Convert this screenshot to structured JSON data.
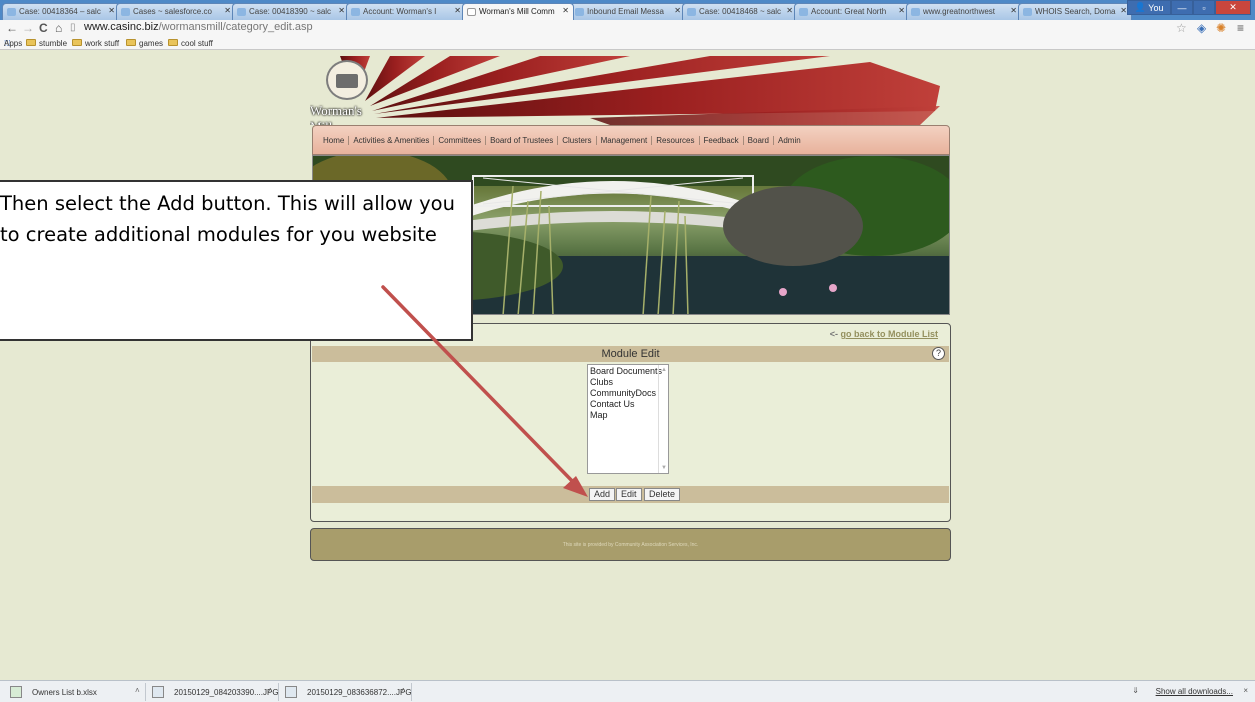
{
  "browser": {
    "tabs": [
      {
        "title": "Case: 00418364 – salc",
        "active": false
      },
      {
        "title": "Cases ~ salesforce.co",
        "active": false
      },
      {
        "title": "Case: 00418390 ~ salc",
        "active": false
      },
      {
        "title": "Account: Worman's I",
        "active": false
      },
      {
        "title": "Worman's Mill Comm",
        "active": true
      },
      {
        "title": "Inbound Email Messa",
        "active": false
      },
      {
        "title": "Case: 00418468 ~ salc",
        "active": false
      },
      {
        "title": "Account: Great North",
        "active": false
      },
      {
        "title": "www.greatnorthwest",
        "active": false
      },
      {
        "title": "WHOIS Search, Doma",
        "active": false
      }
    ],
    "user_label": "You",
    "url_host": "www.casinc.biz",
    "url_path": "/wormansmill/category_edit.asp",
    "bookmarks": [
      {
        "label": "Apps"
      },
      {
        "label": "stumble"
      },
      {
        "label": "work stuff"
      },
      {
        "label": "games"
      },
      {
        "label": "cool stuff"
      }
    ]
  },
  "site": {
    "logo_text": "Worman's Mill",
    "nav": [
      "Home",
      "Activities & Amenities",
      "Committees",
      "Board of Trustees",
      "Clusters",
      "Management",
      "Resources",
      "Feedback",
      "Board",
      "Admin"
    ],
    "back_link_prefix": "<- ",
    "back_link_text": "go back to Module List",
    "module_title": "Module Edit",
    "help_symbol": "?",
    "modules": [
      "Board Documents",
      "Clubs",
      "CommunityDocs",
      "Contact Us",
      "Map"
    ],
    "buttons": {
      "add": "Add",
      "edit": "Edit",
      "delete": "Delete"
    },
    "footer_text": "This site is provided by Community Association Services, Inc."
  },
  "callout": {
    "text": "Then select the Add button.  This will allow you to create additional modules for you website"
  },
  "downloads": {
    "items": [
      "Owners List b.xlsx",
      "20150129_084203390....JPG",
      "20150129_083636872....JPG"
    ],
    "show_all": "Show all downloads...",
    "close": "×"
  },
  "colors": {
    "page_bg": "#e6e9d2",
    "panel_tan": "#cbbd9b",
    "ray_red": "#8e1b1b",
    "arrow_red": "#c0504d"
  }
}
